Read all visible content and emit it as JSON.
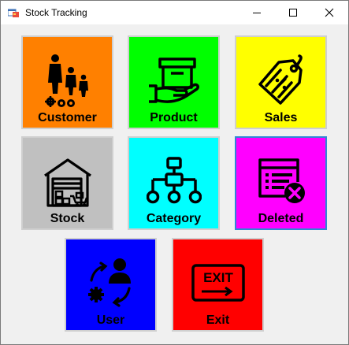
{
  "window": {
    "title": "Stock Tracking"
  },
  "tiles": [
    {
      "label": "Customer",
      "color": "#ff8000",
      "icon": "people-icon"
    },
    {
      "label": "Product",
      "color": "#00ff00",
      "icon": "box-in-hand-icon"
    },
    {
      "label": "Sales",
      "color": "#ffff00",
      "icon": "price-tag-icon"
    },
    {
      "label": "Stock",
      "color": "#c0c0c0",
      "icon": "warehouse-icon"
    },
    {
      "label": "Category",
      "color": "#00ffff",
      "icon": "hierarchy-icon"
    },
    {
      "label": "Deleted",
      "color": "#ff00ff",
      "icon": "delete-list-icon"
    },
    {
      "label": "User",
      "color": "#0000ff",
      "icon": "user-settings-icon"
    },
    {
      "label": "Exit",
      "color": "#ff0000",
      "icon": "exit-sign-icon"
    }
  ]
}
